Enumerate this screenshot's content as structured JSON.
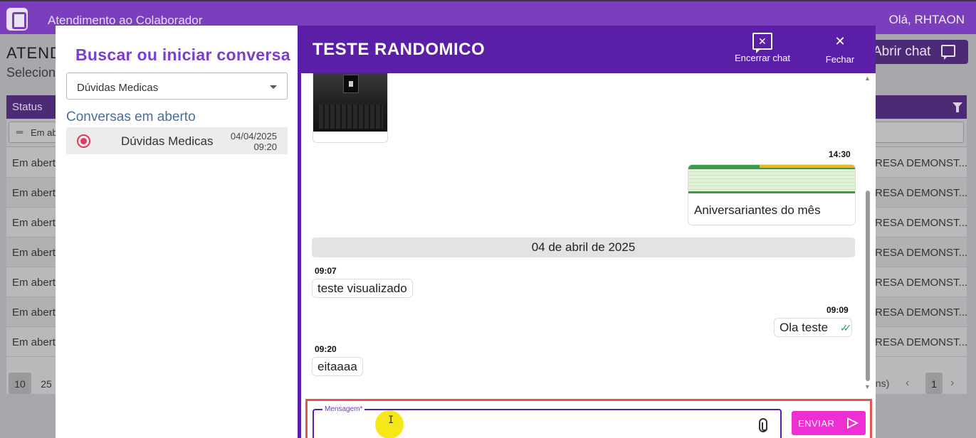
{
  "app": {
    "title": "Atendimento ao Colaborador",
    "greeting": "Olá, RHTAON"
  },
  "background": {
    "heading": "ATEND",
    "subheading": "Selecion",
    "open_chat_label": "Abrir chat",
    "table": {
      "header_status": "Status",
      "filter_text": "Em ab",
      "rows": [
        {
          "status": "Em aberto",
          "company": "RESA DEMONST..."
        },
        {
          "status": "Em aberto",
          "company": "RESA DEMONST..."
        },
        {
          "status": "Em aberto",
          "company": "RESA DEMONST..."
        },
        {
          "status": "Em aberto",
          "company": "RESA DEMONST..."
        },
        {
          "status": "Em aberto",
          "company": "RESA DEMONST..."
        },
        {
          "status": "Em aberto",
          "company": "RESA DEMONST..."
        },
        {
          "status": "Em aberto",
          "company": "RESA DEMONST..."
        }
      ]
    },
    "pager": {
      "page_sizes": [
        "10",
        "25"
      ],
      "items_label": "ens)",
      "current_page": "1"
    }
  },
  "sidebar": {
    "title": "Buscar ou iniciar conversa",
    "select_value": "Dúvidas Medicas",
    "open_conversations_label": "Conversas em aberto",
    "conversations": [
      {
        "name": "Dúvidas Medicas",
        "date": "04/04/2025",
        "time": "09:20"
      }
    ]
  },
  "chat": {
    "title": "TESTE RANDOMICO",
    "end_chat_label": "Encerrar chat",
    "close_label": "Fechar",
    "messages": [
      {
        "time": "14:30",
        "caption": "Aniversariantes do mês"
      },
      {
        "date_separator": "04 de abril de 2025"
      },
      {
        "time": "09:07",
        "text": "teste visualizado"
      },
      {
        "time": "09:09",
        "text": "Ola teste"
      },
      {
        "time": "09:20",
        "text": "eitaaaa"
      }
    ],
    "composer": {
      "label": "Mensagem*",
      "send_label": "ENVIAR"
    }
  },
  "colors": {
    "header_purple": "#5a1fa6",
    "accent_violet": "#7a3fd1",
    "send_pink": "#ee2fd4",
    "highlight_red": "#e8524f"
  }
}
